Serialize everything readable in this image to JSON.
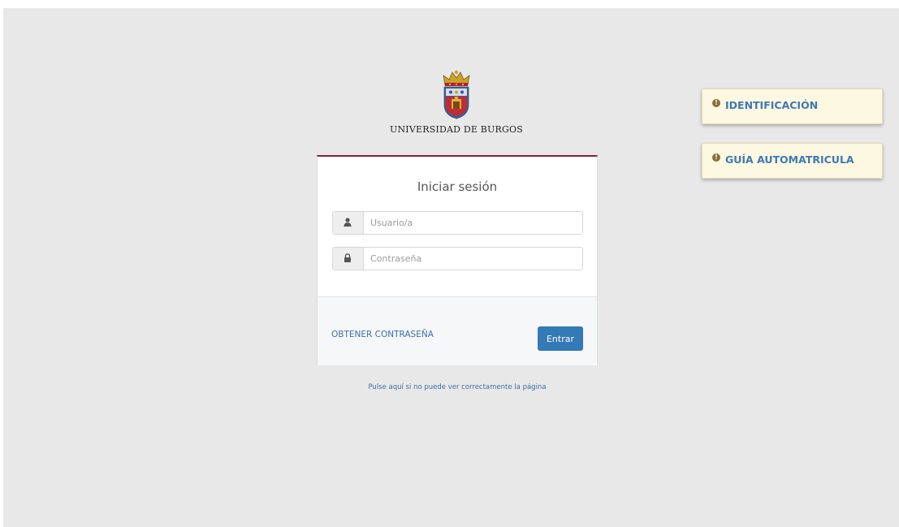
{
  "header": {
    "university_name": "UNIVERSIDAD DE BURGOS"
  },
  "login": {
    "title": "Iniciar sesión",
    "username_placeholder": "Usuario/a",
    "password_placeholder": "Contraseña",
    "username_value": "",
    "password_value": "",
    "forgot_link": "OBTENER CONTRASEÑA",
    "submit_label": "Entrar"
  },
  "help_link": "Pulse aquí si no puede ver correctamente la página",
  "notes": [
    {
      "label": "IDENTIFICACIÓN",
      "icon": "exclamation-circle-icon"
    },
    {
      "label": "GUÍA AUTOMATRICULA",
      "icon": "exclamation-circle-icon"
    }
  ],
  "icons": {
    "user": "user-icon",
    "lock": "lock-icon",
    "crest": "university-crest-icon"
  },
  "colors": {
    "accent_top_border": "#8a1e33",
    "primary_button": "#337ab7",
    "link": "#3a6fa8",
    "note_background": "#fcf8e1",
    "page_background": "#e8e8e8"
  }
}
